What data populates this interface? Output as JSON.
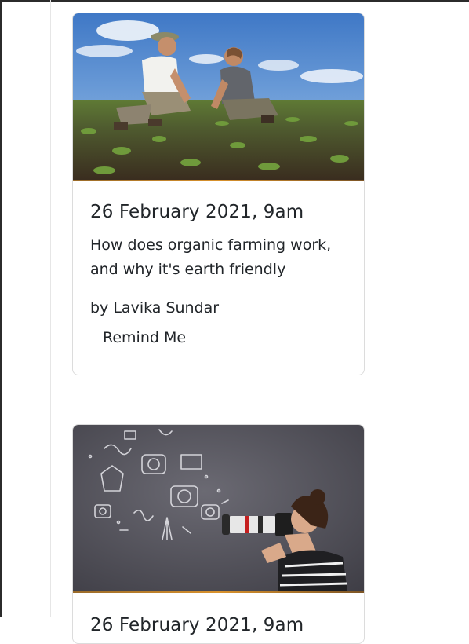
{
  "events": [
    {
      "date": "26 February 2021, 9am",
      "title": "How does organic farming work, and why it's earth friendly",
      "author": "by Lavika Sundar",
      "remind_label": "Remind Me",
      "image": "farmers-in-field-photo"
    },
    {
      "date": "26 February 2021, 9am",
      "image": "photographer-with-camera-photo"
    }
  ]
}
